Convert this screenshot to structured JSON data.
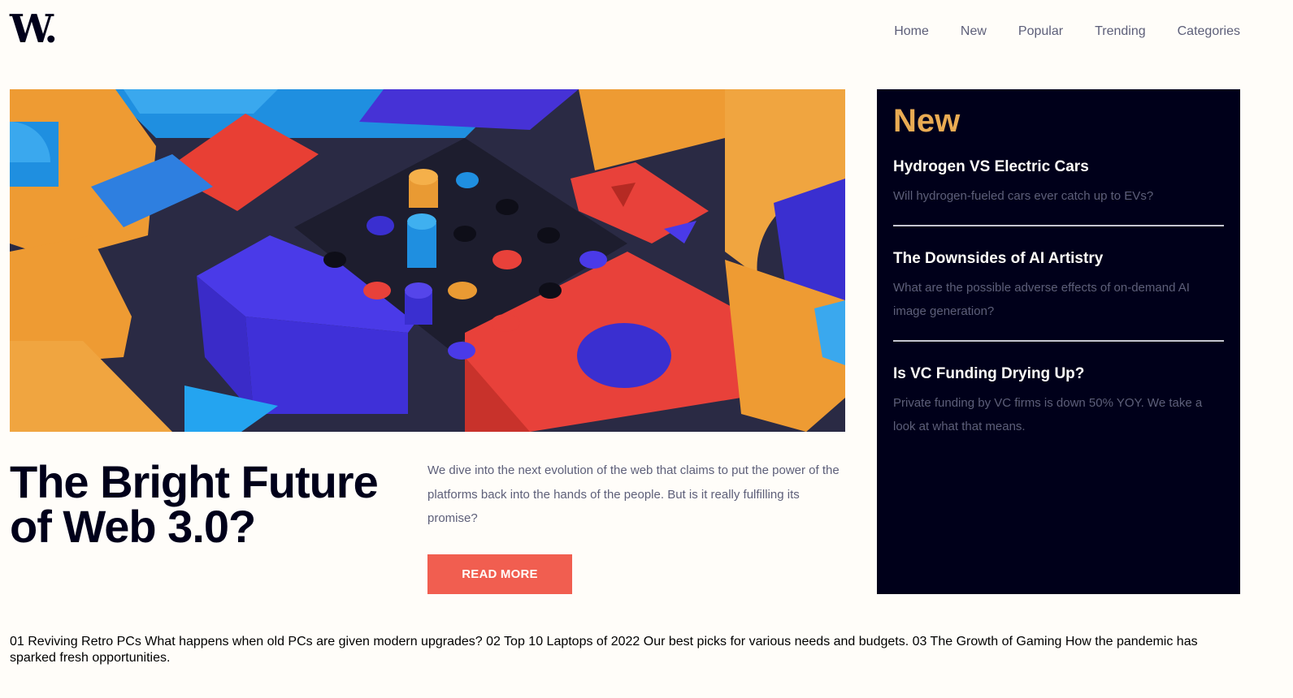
{
  "logo": "W.",
  "nav": [
    "Home",
    "New",
    "Popular",
    "Trending",
    "Categories"
  ],
  "hero": {
    "image_alt": "abstract 3D blocks",
    "title": "The Bright Future of Web 3.0?",
    "description": "We dive into the next evolution of the web that claims to put the power of the platforms back into the hands of the people. But is it really fulfilling its promise?",
    "button": "Read more"
  },
  "new_panel": {
    "heading": "New",
    "items": [
      {
        "title": "Hydrogen VS Electric Cars",
        "summary": "Will hydrogen-fueled cars ever catch up to EVs?"
      },
      {
        "title": "The Downsides of AI Artistry",
        "summary": "What are the possible adverse effects of on-demand AI image generation?"
      },
      {
        "title": "Is VC Funding Drying Up?",
        "summary": "Private funding by VC firms is down 50% YOY. We take a look at what that means."
      }
    ]
  },
  "bottom_text": "01 Reviving Retro PCs What happens when old PCs are given modern upgrades? 02 Top 10 Laptops of 2022 Our best picks for various needs and budgets. 03 The Growth of Gaming How the pandemic has sparked fresh opportunities.",
  "colors": {
    "background": "#fffdf9",
    "dark_navy": "#00001a",
    "accent_orange": "#e9ab53",
    "accent_red": "#f15e50",
    "muted_text": "#5d5f79"
  }
}
